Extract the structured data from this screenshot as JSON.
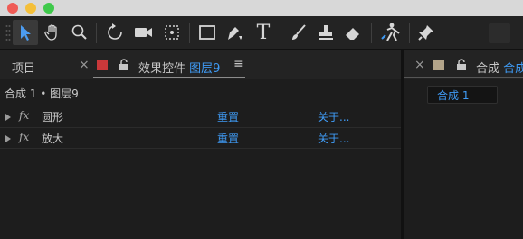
{
  "window": {
    "traffic_lights": [
      "#ef5b55",
      "#f4bf39",
      "#3fc94b"
    ]
  },
  "toolbar": {
    "tools": [
      {
        "name": "selection-tool-icon",
        "active": true
      },
      {
        "name": "hand-tool-icon",
        "active": false
      },
      {
        "name": "zoom-tool-icon",
        "active": false
      },
      {
        "name": "rotate-tool-icon",
        "active": false
      },
      {
        "name": "camera-tool-icon",
        "active": false
      },
      {
        "name": "pan-behind-tool-icon",
        "active": false
      },
      {
        "name": "rectangle-tool-icon",
        "active": false
      },
      {
        "name": "pen-tool-icon",
        "active": false
      },
      {
        "name": "type-tool-icon",
        "active": false,
        "glyph": "T"
      },
      {
        "name": "brush-tool-icon",
        "active": false
      },
      {
        "name": "clone-stamp-tool-icon",
        "active": false
      },
      {
        "name": "eraser-tool-icon",
        "active": false
      },
      {
        "name": "puppet-tool-icon",
        "active": false
      },
      {
        "name": "pin-tool-icon",
        "active": false
      }
    ]
  },
  "left_panel": {
    "tab_project": "项目",
    "tab_close": "×",
    "layer_color": "#c9383a",
    "lock_glyph": "🔓",
    "tab_effects": "效果控件",
    "tab_layer": "图层9",
    "tab_menu": "≡",
    "breadcrumb": "合成 1 • 图层9",
    "effects": [
      {
        "fx": "fx",
        "name": "圆形",
        "reset": "重置",
        "about": "关于..."
      },
      {
        "fx": "fx",
        "name": "放大",
        "reset": "重置",
        "about": "关于..."
      }
    ]
  },
  "right_panel": {
    "tab_close": "×",
    "comp_color": "#b3a48a",
    "lock_glyph": "🔓",
    "tab_comp": "合成",
    "tab_comp_name": "合成",
    "comp_button": "合成 1"
  },
  "colors": {
    "accent_blue": "#3f9bf5",
    "tool_blue": "#4c9cf0"
  }
}
